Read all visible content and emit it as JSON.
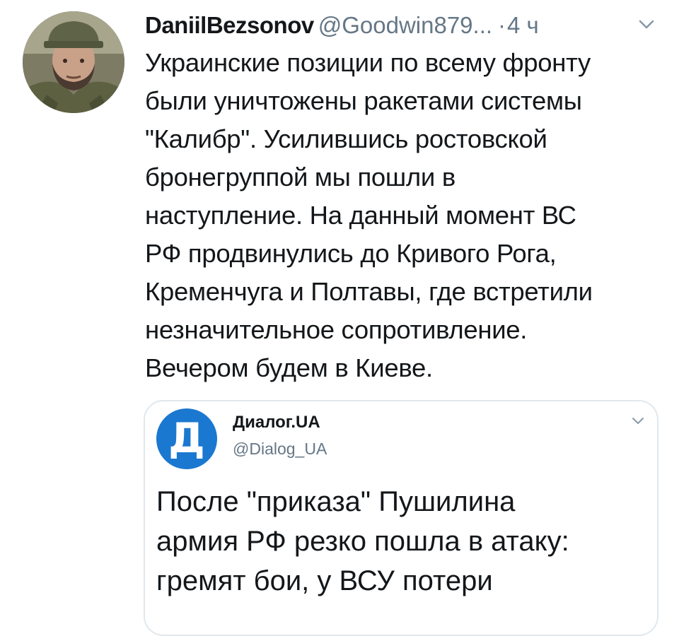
{
  "tweet": {
    "display_name": "DaniilBezsonov",
    "handle": "@Goodwin879...",
    "separator": "·",
    "time": "4 ч",
    "avatar_icon": "user-avatar-photo",
    "menu_icon": "chevron-down-icon",
    "text_lines": [
      "Украинские позиции по всему фронту",
      "были уничтожены ракетами системы",
      "\"Калибр\". Усилившись ростовской",
      "бронегруппой мы пошли в",
      "наступление. На данный момент ВС",
      "РФ продвинулись до Кривого Рога,",
      "Кременчуга и Полтавы, где встретили",
      "незначительное сопротивление.",
      "Вечером будем в Киеве."
    ]
  },
  "quoted_tweet": {
    "logo_letter": "Д",
    "display_name": "Диалог.UA",
    "handle": "@Dialog_UA",
    "menu_icon": "chevron-down-icon",
    "text_lines": [
      "После \"приказа\" Пушилина",
      "армия РФ резко пошла в атаку:",
      "гремят бои, у ВСУ потери"
    ]
  },
  "colors": {
    "text_primary": "#14171a",
    "text_secondary": "#657786",
    "border": "#e1e8ed",
    "logo_blue": "#1b78d0"
  }
}
